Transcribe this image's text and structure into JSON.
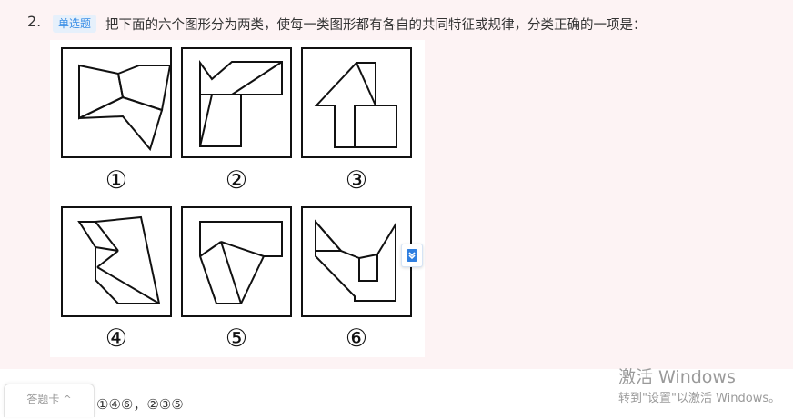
{
  "question": {
    "number": "2.",
    "type_badge": "单选题",
    "stem": "把下面的六个图形分为两类，使每一类图形都有各自的共同特征或规律，分类正确的一项是："
  },
  "figures": {
    "labels": [
      "①",
      "②",
      "③",
      "④",
      "⑤",
      "⑥"
    ]
  },
  "bottom": {
    "answer_card_label": "答题卡",
    "answer_card_chevron": "^",
    "answer_text": "①④⑥，②③⑤"
  },
  "watermark": {
    "line1": "激活 Windows",
    "line2": "转到\"设置\"以激活 Windows。"
  },
  "colors": {
    "page_background": "#fdf3f4",
    "badge_text": "#3a8ee6",
    "badge_background": "#e6f0fb",
    "watermark": "#9a9a9a"
  },
  "icons": {
    "side_tool": "bookmark-download-icon"
  }
}
